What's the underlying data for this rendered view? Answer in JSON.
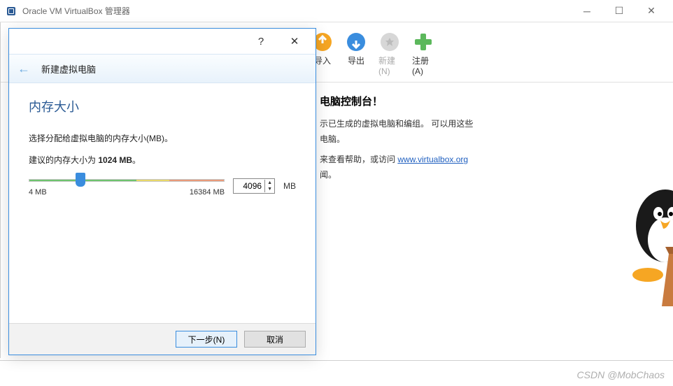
{
  "window": {
    "title": "Oracle VM VirtualBox 管理器"
  },
  "toolbar": {
    "import": "导入",
    "export": "导出",
    "new": "新建(N)",
    "register": "注册(A)"
  },
  "welcome": {
    "heading_suffix": "电脑控制台！",
    "line1a": "示已生成的虚拟电脑和编组。 可以用这些",
    "line1b": "电脑。",
    "line2_prefix": "来查看帮助，或访问 ",
    "link": "www.virtualbox.org",
    "line2_suffix": "闻。"
  },
  "dialog": {
    "subtitle": "新建虚拟电脑",
    "heading": "内存大小",
    "desc": "选择分配给虚拟电脑的内存大小(MB)。",
    "recommended_prefix": "建议的内存大小为 ",
    "recommended_value": "1024 MB",
    "recommended_suffix": "。",
    "min_label": "4 MB",
    "max_label": "16384 MB",
    "value": "4096",
    "unit": "MB",
    "next": "下一步(N)",
    "cancel": "取消"
  },
  "watermark": "CSDN @MobChaos"
}
